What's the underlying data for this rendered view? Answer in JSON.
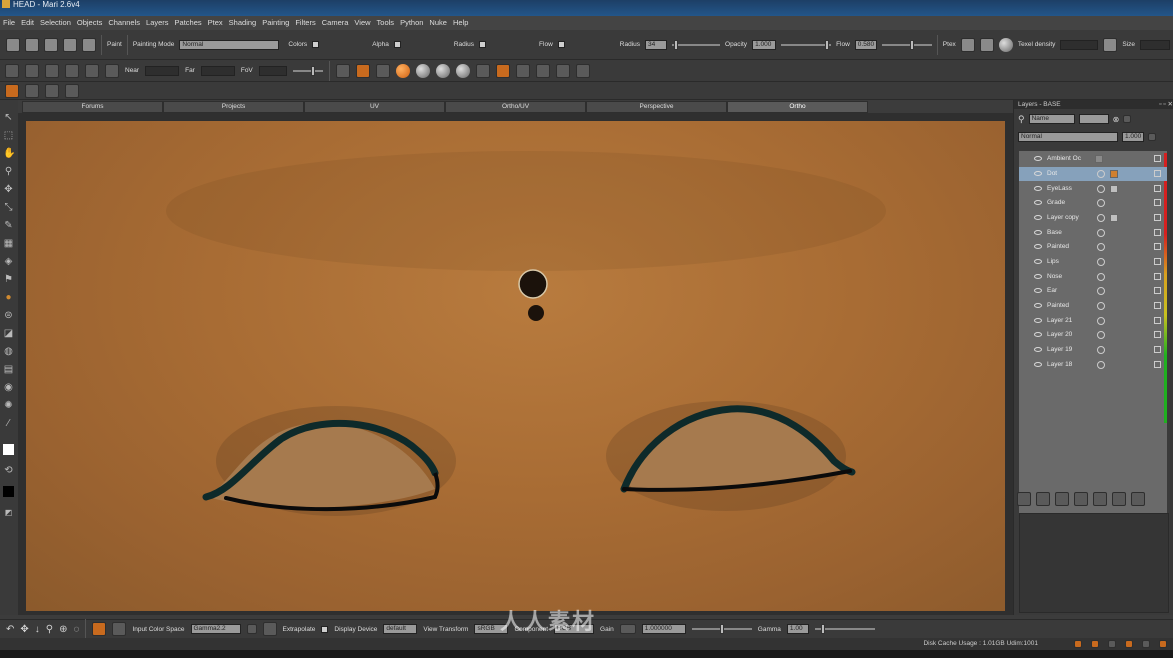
{
  "window": {
    "title": "HEAD - Mari 2.6v4"
  },
  "menu": [
    "File",
    "Edit",
    "Selection",
    "Objects",
    "Channels",
    "Layers",
    "Patches",
    "Ptex",
    "Shading",
    "Painting",
    "Filters",
    "Camera",
    "View",
    "Tools",
    "Python",
    "Nuke",
    "Help"
  ],
  "toolbar1": {
    "paint_label": "Paint",
    "painting_mode_label": "Painting Mode",
    "painting_mode_value": "Normal",
    "colors_label": "Colors",
    "alpha_label": "Alpha",
    "radius_label": "Radius",
    "flow_label": "Flow",
    "radius_value_label": "Radius",
    "radius_value": "34",
    "opacity_label": "Opacity",
    "opacity_value": "1.000",
    "flow_value_label": "Flow",
    "flow_value": "0.580",
    "ptex_label": "Ptex",
    "texel_density_label": "Texel density",
    "size_label": "Size"
  },
  "toolbar2": {
    "near_label": "Near",
    "far_label": "Far",
    "fov_label": "FoV"
  },
  "tabs": [
    "Forums",
    "Projects",
    "UV",
    "Ortho/UV",
    "Perspective",
    "Ortho"
  ],
  "active_tab": "Ortho",
  "layers_panel": {
    "title": "Layers - BASE",
    "filter_value": "Name",
    "blend_mode": "Normal",
    "opacity": "1.000",
    "layers": [
      {
        "name": "Ambient Oc",
        "selected": false
      },
      {
        "name": "Dot",
        "selected": true
      },
      {
        "name": "EyeLass",
        "selected": false
      },
      {
        "name": "Grade",
        "selected": false
      },
      {
        "name": "Layer copy",
        "selected": false
      },
      {
        "name": "Base",
        "selected": false
      },
      {
        "name": "Painted",
        "selected": false
      },
      {
        "name": "Lips",
        "selected": false
      },
      {
        "name": "Nose",
        "selected": false
      },
      {
        "name": "Ear",
        "selected": false
      },
      {
        "name": "Painted",
        "selected": false
      },
      {
        "name": "Layer 21",
        "selected": false
      },
      {
        "name": "Layer 20",
        "selected": false
      },
      {
        "name": "Layer 19",
        "selected": false
      },
      {
        "name": "Layer 18",
        "selected": false
      }
    ]
  },
  "bottombar": {
    "input_color_space_label": "Input Color Space",
    "input_color_space_value": "Gamma2.2",
    "extrapolate_label": "Extrapolate",
    "display_device_label": "Display Device",
    "display_device_value": "default",
    "view_transform_label": "View Transform",
    "view_transform_value": "sRGB",
    "component_label": "Component",
    "component_value": "RGB",
    "gain_label": "Gain",
    "gain_value": "1.000000",
    "gamma_label": "Gamma",
    "gamma_value": "1.00"
  },
  "status": {
    "disk_cache": "Disk Cache Usage : 1.01GB Udim:1001"
  },
  "watermark": "人人素材"
}
